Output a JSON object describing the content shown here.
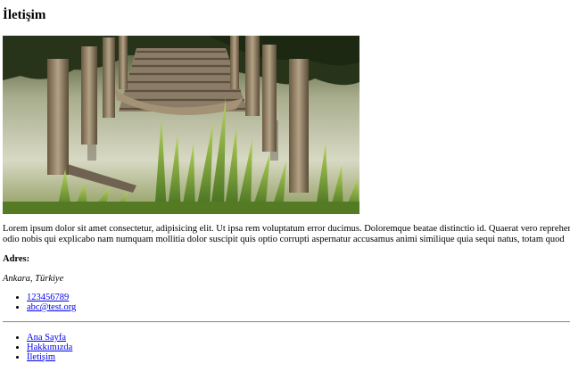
{
  "page": {
    "title": "İletişim"
  },
  "hero": {
    "alt": "Göl kenarında eski ahşap iskele"
  },
  "intro": {
    "line1": "Lorem ipsum dolor sit amet consectetur, adipisicing elit. Ut ipsa rem voluptatum error ducimus. Doloremque beatae distinctio id. Quaerat vero reprehenderit",
    "line2": "odio nobis qui explicabo nam numquam mollitia dolor suscipit quis optio corrupti aspernatur accusamus animi similique quia sequi natus, totam quod"
  },
  "address": {
    "label": "Adres:",
    "value": "Ankara, Türkiye"
  },
  "contact": {
    "phone": "123456789",
    "email": "abc@test.org"
  },
  "nav": {
    "home": "Ana Sayfa",
    "about": "Hakkımızda",
    "contact": "İletişim"
  }
}
